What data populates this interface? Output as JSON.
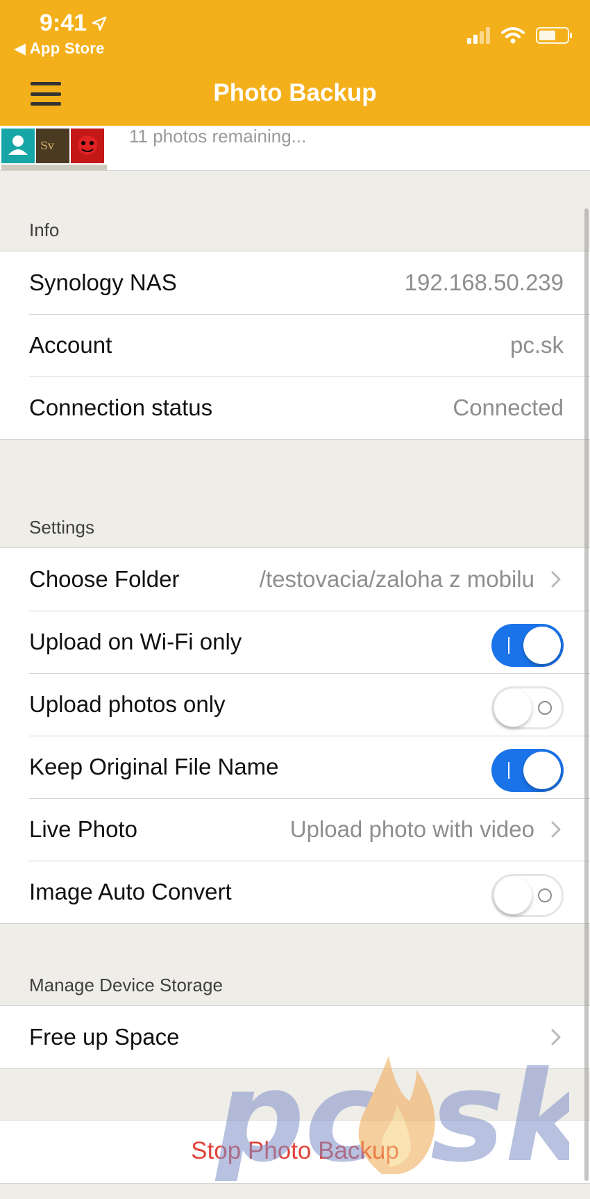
{
  "status_bar": {
    "time": "9:41",
    "back_label": "◀ App Store"
  },
  "header": {
    "title": "Photo Backup"
  },
  "progress": {
    "text": "11 photos remaining..."
  },
  "info": {
    "header": "Info",
    "rows": [
      {
        "label": "Synology NAS",
        "value": "192.168.50.239"
      },
      {
        "label": "Account",
        "value": "pc.sk"
      },
      {
        "label": "Connection status",
        "value": "Connected"
      }
    ]
  },
  "settings": {
    "header": "Settings",
    "choose_folder": {
      "label": "Choose Folder",
      "value": "/testovacia/zaloha z mobilu"
    },
    "upload_wifi": {
      "label": "Upload on Wi-Fi only",
      "state": "on"
    },
    "upload_photos": {
      "label": "Upload photos only",
      "state": "off"
    },
    "keep_name": {
      "label": "Keep Original File Name",
      "state": "on"
    },
    "live_photo": {
      "label": "Live Photo",
      "value": "Upload photo with video"
    },
    "auto_convert": {
      "label": "Image Auto Convert",
      "state": "off"
    }
  },
  "storage": {
    "header": "Manage Device Storage",
    "free_space": {
      "label": "Free up Space"
    }
  },
  "stop_button": {
    "label": "Stop Photo Backup"
  },
  "watermark": {
    "text": "pc sk"
  },
  "colors": {
    "header_bg": "#f4b01b",
    "toggle_on": "#1a73e8",
    "destructive": "#e0443a",
    "value_text": "#8e8e8e"
  }
}
